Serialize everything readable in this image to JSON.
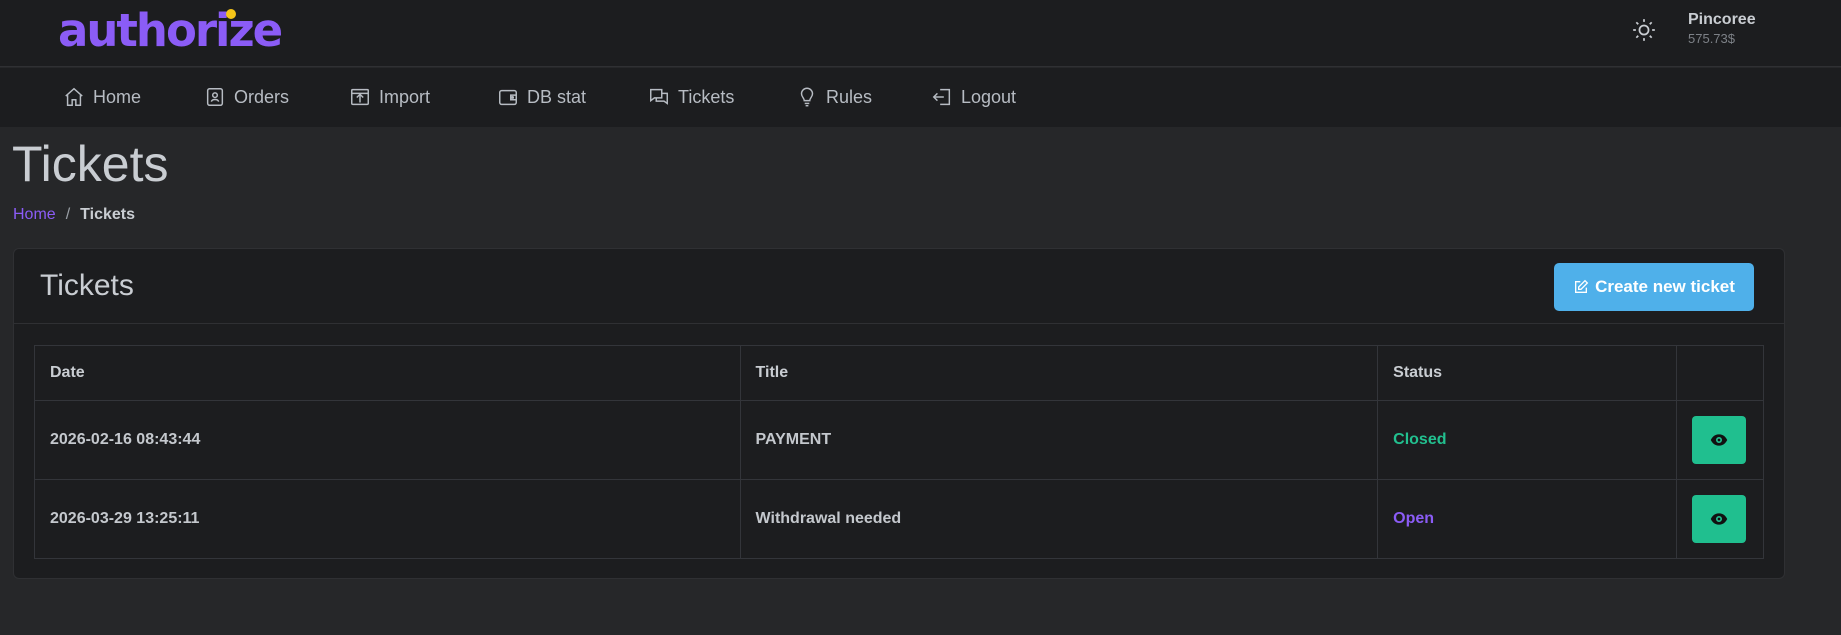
{
  "brand": {
    "logo_text": "authorize",
    "accent": "#8b5cf6",
    "dot_color": "#f5c518"
  },
  "header": {
    "theme_icon": "sun-icon",
    "user_name": "Pincoree",
    "balance": "575.73$"
  },
  "nav": {
    "items": [
      {
        "label": "Home",
        "icon": "home-icon"
      },
      {
        "label": "Orders",
        "icon": "orders-icon"
      },
      {
        "label": "Import",
        "icon": "import-icon"
      },
      {
        "label": "DB stat",
        "icon": "wallet-icon"
      },
      {
        "label": "Tickets",
        "icon": "chat-icon"
      },
      {
        "label": "Rules",
        "icon": "lightbulb-icon"
      },
      {
        "label": "Logout",
        "icon": "logout-icon"
      }
    ]
  },
  "page": {
    "title": "Tickets",
    "breadcrumb": {
      "home": "Home",
      "separator": "/",
      "current": "Tickets"
    }
  },
  "card": {
    "title": "Tickets",
    "create_button": "Create new ticket",
    "create_button_color": "#4fb0ea"
  },
  "table": {
    "headers": {
      "date": "Date",
      "title": "Title",
      "status": "Status",
      "action": ""
    },
    "rows": [
      {
        "date": "2026-02-16 08:43:44",
        "title": "PAYMENT",
        "status": "Closed",
        "status_color": "#22c08f"
      },
      {
        "date": "2026-03-29 13:25:11",
        "title": "Withdrawal needed",
        "status": "Open",
        "status_color": "#8b5cf6"
      }
    ],
    "view_button_color": "#20bf8f"
  }
}
